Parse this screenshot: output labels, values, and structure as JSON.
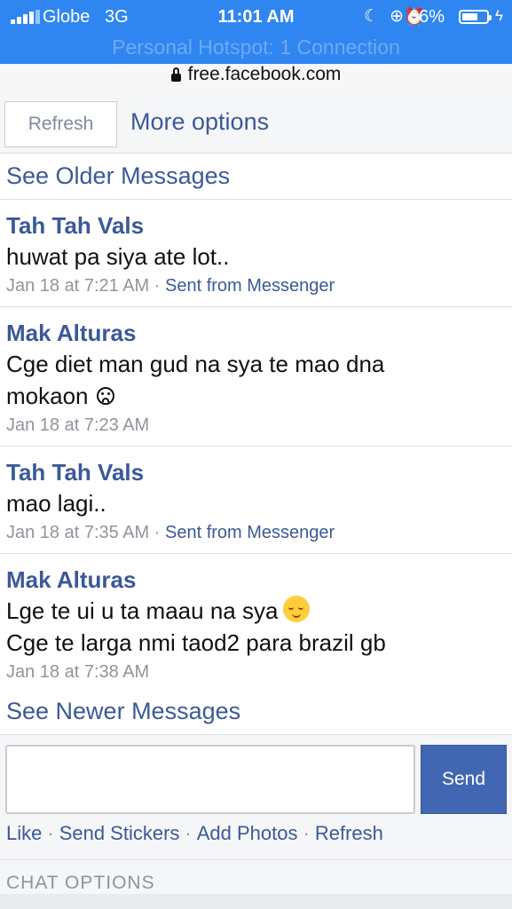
{
  "status_bar": {
    "carrier": "Globe",
    "network": "3G",
    "time": "11:01 AM",
    "battery_percent": "66%",
    "battery_level": 0.66,
    "hotspot": "Personal Hotspot: 1 Connection",
    "icons": [
      "moon-icon",
      "orientation-lock-icon",
      "alarm-icon",
      "battery-icon",
      "charging-bolt-icon"
    ]
  },
  "url_bar": {
    "url": "free.facebook.com"
  },
  "toolbar": {
    "refresh_label": "Refresh",
    "more_options_label": "More options"
  },
  "see_older": "See Older Messages",
  "messages": [
    {
      "name": "Tah Tah Vals",
      "lines": [
        "huwat pa siya ate lot.."
      ],
      "time": "Jan 18 at 7:21 AM",
      "sent_from": "Sent from Messenger"
    },
    {
      "name": "Mak Alturas",
      "lines": [
        "Cge diet man gud na sya te mao dna",
        "mokaon"
      ],
      "time": "Jan 18 at 7:23 AM"
    },
    {
      "name": "Tah Tah Vals",
      "lines": [
        "mao lagi.."
      ],
      "time": "Jan 18 at 7:35 AM",
      "sent_from": "Sent from Messenger"
    },
    {
      "name": "Mak Alturas",
      "lines": [
        "Lge te ui u ta maau na sya",
        "Cge te larga nmi taod2 para brazil gb"
      ],
      "time": "Jan 18 at 7:38 AM"
    }
  ],
  "see_newer": "See Newer Messages",
  "compose": {
    "send_label": "Send"
  },
  "actions": {
    "like": "Like",
    "stickers": "Send Stickers",
    "photos": "Add Photos",
    "refresh": "Refresh"
  },
  "chat_options": "CHAT OPTIONS",
  "colors": {
    "status_bar": "#2f86f0",
    "link": "#3b5998",
    "send_button": "#4267b2"
  }
}
